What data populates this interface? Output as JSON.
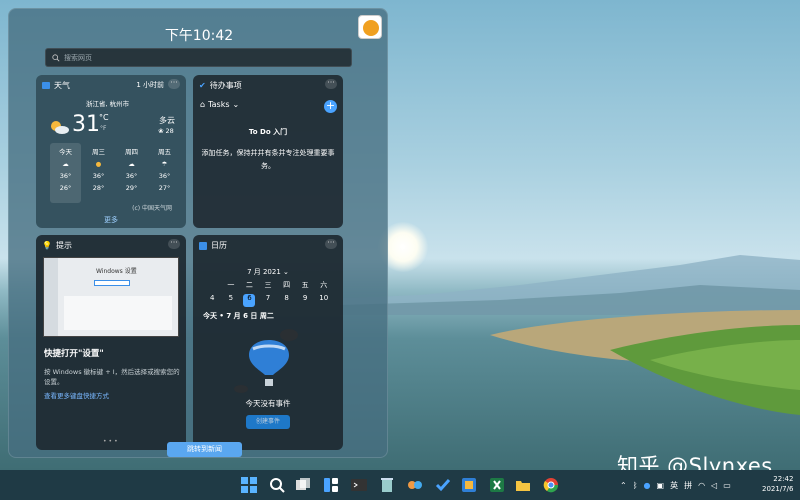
{
  "widgets": {
    "clock": "下午10:42",
    "search_placeholder": "搜索网页",
    "weather": {
      "title": "天气",
      "updated": "1 小时前",
      "location": "浙江省, 杭州市",
      "temp": "31",
      "unit_c": "°C",
      "unit_f": "°F",
      "condition": "多云",
      "wind": "28",
      "days": [
        {
          "name": "今天",
          "high": "36°",
          "low": "26°"
        },
        {
          "name": "周三",
          "high": "36°",
          "low": "28°"
        },
        {
          "name": "周四",
          "high": "36°",
          "low": "29°"
        },
        {
          "name": "周五",
          "high": "36°",
          "low": "27°"
        }
      ],
      "source": "(c) 中国天气网",
      "more": "更多"
    },
    "todo": {
      "title": "待办事项",
      "list": "Tasks",
      "heading": "To Do 入门",
      "desc": "添加任务，保持井井有条并专注处理重要事务。"
    },
    "tips": {
      "title": "提示",
      "shot_title": "Windows 设置",
      "heading": "快捷打开\"设置\"",
      "body": "按 Windows 徽标键 + I，然后选择或搜索您的设置。",
      "link": "查看更多键盘快捷方式"
    },
    "calendar": {
      "title": "日历",
      "month": "7 月 2021",
      "weekdays": [
        "一",
        "二",
        "三",
        "四",
        "五",
        "六"
      ],
      "dates": [
        "4",
        "5",
        "6",
        "7",
        "8",
        "9",
        "10"
      ],
      "today_label": "今天 • 7 月 6 日 周二",
      "no_events": "今天没有事件",
      "add_event": "创建事件"
    },
    "news_button": "跳转到新闻"
  },
  "watermark": "知乎 @Slynxes",
  "taskbar": {
    "ime_lang": "英",
    "ime_mode": "拼",
    "time": "22:42",
    "date": "2021/7/6"
  },
  "colors": {
    "accent": "#4aa3ff",
    "news_button": "#5aa7f0",
    "taskbar": "#1f3a45"
  }
}
